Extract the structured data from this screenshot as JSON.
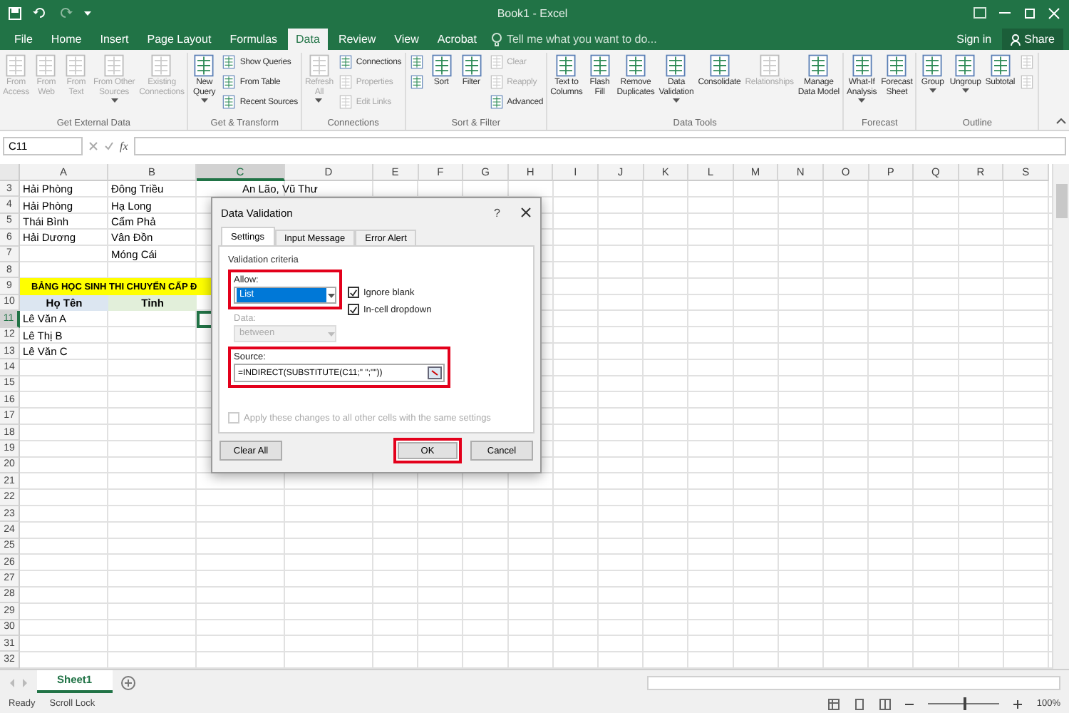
{
  "title_bar": {
    "title": "Book1 - Excel"
  },
  "ribbon_tabs": [
    {
      "label": "File",
      "selected": false
    },
    {
      "label": "Home",
      "selected": false
    },
    {
      "label": "Insert",
      "selected": false
    },
    {
      "label": "Page Layout",
      "selected": false
    },
    {
      "label": "Formulas",
      "selected": false
    },
    {
      "label": "Data",
      "selected": true
    },
    {
      "label": "Review",
      "selected": false
    },
    {
      "label": "View",
      "selected": false
    },
    {
      "label": "Acrobat",
      "selected": false
    }
  ],
  "tell_me": {
    "placeholder": "Tell me what you want to do..."
  },
  "account": {
    "sign_in": "Sign in",
    "share": "Share"
  },
  "ribbon_groups": [
    {
      "label": "Get External Data",
      "buttons": [
        {
          "kind": "large",
          "lines": [
            "From",
            "Access"
          ],
          "disabled": true,
          "menu": false
        },
        {
          "kind": "large",
          "lines": [
            "From",
            "Web"
          ],
          "disabled": true,
          "menu": false
        },
        {
          "kind": "large",
          "lines": [
            "From",
            "Text"
          ],
          "disabled": true,
          "menu": false
        },
        {
          "kind": "large",
          "lines": [
            "From Other",
            "Sources"
          ],
          "disabled": true,
          "menu": true
        },
        {
          "kind": "large",
          "lines": [
            "Existing",
            "Connections"
          ],
          "disabled": true,
          "menu": false
        }
      ]
    },
    {
      "label": "Get & Transform",
      "buttons": [
        {
          "kind": "large",
          "lines": [
            "New",
            "Query"
          ],
          "disabled": false,
          "menu": true
        },
        {
          "kind": "small",
          "lines": [
            "Show Queries"
          ],
          "disabled": false
        },
        {
          "kind": "small",
          "lines": [
            "From Table"
          ],
          "disabled": false
        },
        {
          "kind": "small",
          "lines": [
            "Recent Sources"
          ],
          "disabled": false
        }
      ]
    },
    {
      "label": "Connections",
      "buttons": [
        {
          "kind": "large",
          "lines": [
            "Refresh",
            "All"
          ],
          "disabled": true,
          "menu": true
        },
        {
          "kind": "small",
          "lines": [
            "Connections"
          ],
          "disabled": false
        },
        {
          "kind": "small",
          "lines": [
            "Properties"
          ],
          "disabled": true
        },
        {
          "kind": "small",
          "lines": [
            "Edit Links"
          ],
          "disabled": true
        }
      ]
    },
    {
      "label": "Sort & Filter",
      "buttons": [
        {
          "kind": "icon",
          "disabled": false
        },
        {
          "kind": "icon",
          "disabled": false
        },
        {
          "kind": "large",
          "lines": [
            "Sort"
          ],
          "disabled": false,
          "menu": false
        },
        {
          "kind": "large",
          "lines": [
            "Filter"
          ],
          "disabled": false,
          "menu": false
        },
        {
          "kind": "small",
          "lines": [
            "Clear"
          ],
          "disabled": true
        },
        {
          "kind": "small",
          "lines": [
            "Reapply"
          ],
          "disabled": true
        },
        {
          "kind": "small",
          "lines": [
            "Advanced"
          ],
          "disabled": false
        }
      ]
    },
    {
      "label": "Data Tools",
      "buttons": [
        {
          "kind": "large",
          "lines": [
            "Text to",
            "Columns"
          ],
          "disabled": false,
          "menu": false
        },
        {
          "kind": "large",
          "lines": [
            "Flash",
            "Fill"
          ],
          "disabled": false,
          "menu": false
        },
        {
          "kind": "large",
          "lines": [
            "Remove",
            "Duplicates"
          ],
          "disabled": false,
          "menu": false
        },
        {
          "kind": "large",
          "lines": [
            "Data",
            "Validation"
          ],
          "disabled": false,
          "menu": true
        },
        {
          "kind": "large",
          "lines": [
            "Consolidate"
          ],
          "disabled": false,
          "menu": false
        },
        {
          "kind": "large",
          "lines": [
            "Relationships"
          ],
          "disabled": true,
          "menu": false
        },
        {
          "kind": "large",
          "lines": [
            "Manage",
            "Data Model"
          ],
          "disabled": false,
          "menu": false
        }
      ]
    },
    {
      "label": "Forecast",
      "buttons": [
        {
          "kind": "large",
          "lines": [
            "What-If",
            "Analysis"
          ],
          "disabled": false,
          "menu": true
        },
        {
          "kind": "large",
          "lines": [
            "Forecast",
            "Sheet"
          ],
          "disabled": false,
          "menu": false
        }
      ]
    },
    {
      "label": "Outline",
      "buttons": [
        {
          "kind": "large",
          "lines": [
            "Group"
          ],
          "disabled": false,
          "menu": true
        },
        {
          "kind": "large",
          "lines": [
            "Ungroup"
          ],
          "disabled": false,
          "menu": true
        },
        {
          "kind": "large",
          "lines": [
            "Subtotal"
          ],
          "disabled": false,
          "menu": false
        },
        {
          "kind": "icon",
          "disabled": true
        },
        {
          "kind": "icon",
          "disabled": true
        }
      ]
    }
  ],
  "formula_bar": {
    "name_box": "C11",
    "function_label": "fx"
  },
  "sheet": {
    "columns": [
      {
        "label": "A",
        "selected": false
      },
      {
        "label": "B",
        "selected": false
      },
      {
        "label": "C",
        "selected": true
      },
      {
        "label": "D",
        "selected": false
      },
      {
        "label": "E",
        "selected": false
      },
      {
        "label": "F",
        "selected": false
      },
      {
        "label": "G",
        "selected": false
      },
      {
        "label": "H",
        "selected": false
      },
      {
        "label": "I",
        "selected": false
      },
      {
        "label": "J",
        "selected": false
      },
      {
        "label": "K",
        "selected": false
      },
      {
        "label": "L",
        "selected": false
      },
      {
        "label": "M",
        "selected": false
      },
      {
        "label": "N",
        "selected": false
      },
      {
        "label": "O",
        "selected": false
      },
      {
        "label": "P",
        "selected": false
      },
      {
        "label": "Q",
        "selected": false
      },
      {
        "label": "R",
        "selected": false
      },
      {
        "label": "S",
        "selected": false
      }
    ],
    "rows": [
      {
        "number": "3",
        "kind": "data",
        "selected": false,
        "cells": [
          "Hải Phòng",
          "Đông Triều",
          "An Lão, Vũ Thư"
        ]
      },
      {
        "number": "4",
        "kind": "data",
        "selected": false,
        "cells": [
          "Hải Phòng",
          "Hạ Long"
        ]
      },
      {
        "number": "5",
        "kind": "data",
        "selected": false,
        "cells": [
          "Thái Bình",
          "Cẩm Phả"
        ]
      },
      {
        "number": "6",
        "kind": "data",
        "selected": false,
        "cells": [
          "Hải Dương",
          "Vân Đồn"
        ]
      },
      {
        "number": "7",
        "kind": "data",
        "selected": false,
        "cells": [
          null,
          "Móng Cái"
        ]
      },
      {
        "number": "8",
        "kind": "data",
        "selected": false,
        "cells": []
      },
      {
        "number": "9",
        "kind": "title",
        "selected": false,
        "cells": [
          "BẢNG HỌC SINH THI CHUYỂN CẤP Đ"
        ]
      },
      {
        "number": "10",
        "kind": "header",
        "selected": false,
        "cells": [
          "Họ Tên",
          "Tỉnh"
        ]
      },
      {
        "number": "11",
        "kind": "data",
        "selected": true,
        "cells": [
          "Lê Văn A"
        ]
      },
      {
        "number": "12",
        "kind": "data",
        "selected": false,
        "cells": [
          "Lê Thị B"
        ]
      },
      {
        "number": "13",
        "kind": "data",
        "selected": false,
        "cells": [
          "Lê Văn C"
        ]
      },
      {
        "number": "14",
        "kind": "data",
        "selected": false,
        "cells": []
      },
      {
        "number": "15",
        "kind": "data",
        "selected": false,
        "cells": []
      },
      {
        "number": "16",
        "kind": "data",
        "selected": false,
        "cells": []
      },
      {
        "number": "17",
        "kind": "data",
        "selected": false,
        "cells": []
      },
      {
        "number": "18",
        "kind": "data",
        "selected": false,
        "cells": []
      },
      {
        "number": "19",
        "kind": "data",
        "selected": false,
        "cells": []
      },
      {
        "number": "20",
        "kind": "data",
        "selected": false,
        "cells": []
      },
      {
        "number": "21",
        "kind": "data",
        "selected": false,
        "cells": []
      },
      {
        "number": "22",
        "kind": "data",
        "selected": false,
        "cells": []
      },
      {
        "number": "23",
        "kind": "data",
        "selected": false,
        "cells": []
      },
      {
        "number": "24",
        "kind": "data",
        "selected": false,
        "cells": []
      },
      {
        "number": "25",
        "kind": "data",
        "selected": false,
        "cells": []
      },
      {
        "number": "26",
        "kind": "data",
        "selected": false,
        "cells": []
      },
      {
        "number": "27",
        "kind": "data",
        "selected": false,
        "cells": []
      },
      {
        "number": "28",
        "kind": "data",
        "selected": false,
        "cells": []
      },
      {
        "number": "29",
        "kind": "data",
        "selected": false,
        "cells": []
      },
      {
        "number": "30",
        "kind": "data",
        "selected": false,
        "cells": []
      },
      {
        "number": "31",
        "kind": "data",
        "selected": false,
        "cells": []
      },
      {
        "number": "32",
        "kind": "data",
        "selected": false,
        "cells": []
      }
    ]
  },
  "dialog": {
    "title": "Data Validation",
    "help": "?",
    "tabs": [
      {
        "label": "Settings",
        "selected": true
      },
      {
        "label": "Input Message",
        "selected": false
      },
      {
        "label": "Error Alert",
        "selected": false
      }
    ],
    "section": "Validation criteria",
    "allow": {
      "label": "Allow:",
      "value": "List",
      "highlighted": true
    },
    "options": [
      {
        "label": "Ignore blank",
        "checked": true
      },
      {
        "label": "In-cell dropdown",
        "checked": true
      }
    ],
    "data": {
      "label": "Data:",
      "value": "between",
      "disabled": true
    },
    "source": {
      "label": "Source:",
      "value": "=INDIRECT(SUBSTITUTE(C11;\" \";\"\"))",
      "highlighted": true
    },
    "apply_all": {
      "label": "Apply these changes to all other cells with the same settings",
      "checked": false,
      "disabled": true
    },
    "buttons": [
      {
        "label": "Clear All",
        "highlighted": false
      },
      {
        "label": "OK",
        "highlighted": true
      },
      {
        "label": "Cancel",
        "highlighted": false
      }
    ]
  },
  "sheet_tabs": [
    {
      "label": "Sheet1",
      "selected": true
    }
  ],
  "status_bar": {
    "items": [
      "Ready",
      "Scroll Lock"
    ],
    "zoom": {
      "level": 0.5,
      "reading": "100%"
    }
  }
}
